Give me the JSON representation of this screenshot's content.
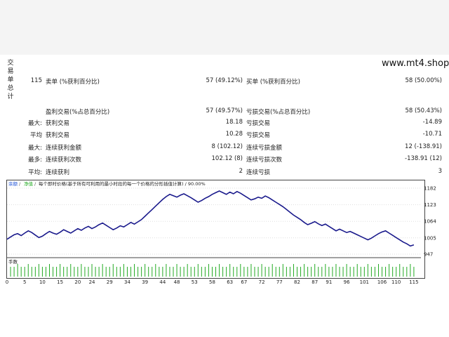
{
  "side_label": [
    "交",
    "易",
    "单",
    "总",
    "计"
  ],
  "watermark": "www.mt4.shop",
  "stats": {
    "row1": {
      "left_value": "115",
      "label1": "卖单 (%获利百分比)",
      "val1": "57 (49.12%)",
      "label2": "买单 (%获利百分比)",
      "val2": "58 (50.00%)"
    },
    "row2": {
      "label1": "盈利交易(%占总百分比)",
      "val1": "57 (49.57%)",
      "label2": "亏损交易(%占总百分比)",
      "val2": "58 (50.43%)"
    },
    "row3": {
      "prefix": "最大:",
      "label1": "获利交易",
      "val1": "18.18",
      "label2": "亏损交易",
      "val2": "-14.89"
    },
    "row4": {
      "prefix": "平均",
      "label1": "获利交易",
      "val1": "10.28",
      "label2": "亏损交易",
      "val2": "-10.71"
    },
    "row5": {
      "prefix": "最大:",
      "label1": "连续获利金额",
      "val1": "8 (102.12)",
      "label2": "连续亏损金额",
      "val2": "12 (-138.91)"
    },
    "row6": {
      "prefix": "最多:",
      "label1": "连续获利次数",
      "val1": "102.12 (8)",
      "label2": "连续亏损次数",
      "val2": "-138.91 (12)"
    },
    "row7": {
      "prefix": "平均:",
      "label1": "连续获利",
      "val1": "2",
      "label2": "连续亏损",
      "val2": "3"
    }
  },
  "chart": {
    "legend": {
      "balance": "余额",
      "equity": "净值",
      "desc": "每个即时价格(基于所有可利用的最小时段的每一个价格的分形插值计算) / 90.00%"
    },
    "volume_label": "手数",
    "colors": {
      "line": "#1a1a8c",
      "volume": "#22aa22",
      "legend_balance": "#1a4fd6",
      "legend_equity": "#22aa22"
    }
  },
  "chart_data": {
    "type": "line",
    "yticks": [
      "1182",
      "1123",
      "1064",
      "1005",
      "947"
    ],
    "ylim": [
      947,
      1182
    ],
    "xticks": [
      "0",
      "5",
      "10",
      "15",
      "20",
      "24",
      "29",
      "34",
      "39",
      "44",
      "48",
      "53",
      "58",
      "63",
      "67",
      "72",
      "77",
      "82",
      "87",
      "91",
      "96",
      "101",
      "106",
      "110",
      "115"
    ],
    "x": [
      0,
      1,
      2,
      3,
      4,
      5,
      6,
      7,
      8,
      9,
      10,
      11,
      12,
      13,
      14,
      15,
      16,
      17,
      18,
      19,
      20,
      21,
      22,
      23,
      24,
      25,
      26,
      27,
      28,
      29,
      30,
      31,
      32,
      33,
      34,
      35,
      36,
      37,
      38,
      39,
      40,
      41,
      42,
      43,
      44,
      45,
      46,
      47,
      48,
      49,
      50,
      51,
      52,
      53,
      54,
      55,
      56,
      57,
      58,
      59,
      60,
      61,
      62,
      63,
      64,
      65,
      66,
      67,
      68,
      69,
      70,
      71,
      72,
      73,
      74,
      75,
      76,
      77,
      78,
      79,
      80,
      81,
      82,
      83,
      84,
      85,
      86,
      87,
      88,
      89,
      90,
      91,
      92,
      93,
      94,
      95,
      96,
      97,
      98,
      99,
      100,
      101,
      102,
      103,
      104,
      105,
      106,
      107,
      108,
      109,
      110,
      111,
      112,
      113,
      114,
      115
    ],
    "series": [
      {
        "values": [
          1000,
          1008,
          1016,
          1020,
          1013,
          1022,
          1030,
          1024,
          1015,
          1006,
          1011,
          1020,
          1028,
          1022,
          1018,
          1025,
          1034,
          1028,
          1022,
          1030,
          1038,
          1032,
          1040,
          1046,
          1038,
          1044,
          1052,
          1058,
          1050,
          1042,
          1034,
          1040,
          1048,
          1044,
          1052,
          1060,
          1054,
          1062,
          1070,
          1082,
          1094,
          1106,
          1118,
          1130,
          1142,
          1152,
          1160,
          1155,
          1150,
          1157,
          1162,
          1155,
          1148,
          1140,
          1132,
          1138,
          1146,
          1152,
          1160,
          1166,
          1172,
          1166,
          1160,
          1168,
          1162,
          1170,
          1164,
          1156,
          1148,
          1140,
          1144,
          1150,
          1146,
          1154,
          1148,
          1140,
          1132,
          1124,
          1116,
          1106,
          1096,
          1086,
          1078,
          1070,
          1060,
          1052,
          1057,
          1063,
          1055,
          1049,
          1054,
          1046,
          1038,
          1030,
          1036,
          1030,
          1024,
          1028,
          1022,
          1016,
          1010,
          1004,
          998,
          1004,
          1012,
          1020,
          1026,
          1030,
          1022,
          1014,
          1006,
          998,
          990,
          984,
          976,
          980
        ]
      }
    ],
    "volume": [
      1,
      1,
      1,
      1,
      1,
      1,
      1,
      1,
      1,
      1,
      1,
      1,
      1,
      1,
      1,
      1,
      1,
      1,
      1,
      1,
      1,
      1,
      1,
      1,
      1,
      1,
      1,
      1,
      1,
      1,
      1,
      1,
      1,
      1,
      1,
      1,
      1,
      1,
      1,
      1,
      1,
      1,
      1,
      1,
      1,
      1,
      1,
      1,
      1,
      1,
      1,
      1,
      1,
      1,
      1,
      1,
      1,
      1,
      1,
      1,
      1,
      1,
      1,
      1,
      1,
      1,
      1,
      1,
      1,
      1,
      1,
      1,
      1,
      1,
      1,
      1,
      1,
      1,
      1,
      1,
      1,
      1,
      1,
      1,
      1,
      1,
      1,
      1,
      1,
      1,
      1,
      1,
      1,
      1,
      1,
      1,
      1,
      1,
      1,
      1,
      1,
      1,
      1,
      1,
      1,
      1,
      1,
      1,
      1,
      1,
      1,
      1,
      1,
      1,
      1,
      1
    ]
  }
}
